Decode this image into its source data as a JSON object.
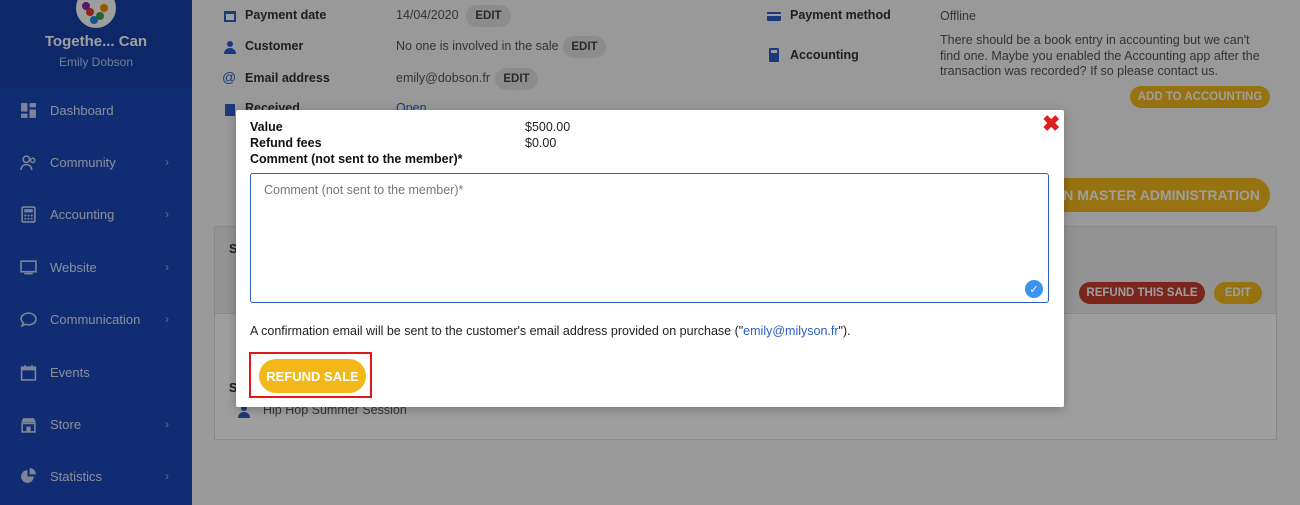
{
  "sidebar": {
    "org_name": "Togethe... Can",
    "user_name": "Emily Dobson",
    "items": [
      {
        "label": "Dashboard",
        "icon": "dashboard-icon",
        "chevron": false
      },
      {
        "label": "Community",
        "icon": "community-icon",
        "chevron": true
      },
      {
        "label": "Accounting",
        "icon": "calculator-icon",
        "chevron": true
      },
      {
        "label": "Website",
        "icon": "monitor-icon",
        "chevron": true
      },
      {
        "label": "Communication",
        "icon": "chat-icon",
        "chevron": true
      },
      {
        "label": "Events",
        "icon": "calendar-icon",
        "chevron": false
      },
      {
        "label": "Store",
        "icon": "store-icon",
        "chevron": true
      },
      {
        "label": "Statistics",
        "icon": "pie-chart-icon",
        "chevron": true
      }
    ],
    "chevron_glyph": "›"
  },
  "details": {
    "payment_date_label": "Payment date",
    "payment_date_value": "14/04/2020",
    "customer_label": "Customer",
    "customer_value": "No one is involved in the sale",
    "email_label": "Email address",
    "email_value": "emily@dobson.fr",
    "received_label": "Received",
    "received_value": "Open",
    "edit_label": "EDIT",
    "payment_method_label": "Payment method",
    "payment_method_value": "Offline",
    "accounting_label": "Accounting",
    "accounting_note": "There should be a book entry in accounting but we can't find one. Maybe you enabled the Accounting app after the transaction was recorded? If so please contact us.",
    "add_to_accounting": "ADD TO ACCOUNTING",
    "master_admin": "IN MASTER ADMINISTRATION",
    "refund_this_sale": "REFUND THIS SALE",
    "product_name": "Hip Hop Summer Session",
    "section_letter_1": "S",
    "section_letter_2": "S"
  },
  "modal": {
    "value_label": "Value",
    "value_amount": "$500.00",
    "refund_fees_label": "Refund fees",
    "refund_fees_amount": "$0.00",
    "comment_label": "Comment (not sent to the member)*",
    "comment_placeholder": "Comment (not sent to the member)*",
    "confirm_prefix": "A confirmation email will be sent to the customer's email address provided on purchase (\"",
    "confirm_email": "emily@milyson.fr",
    "confirm_suffix": "\").",
    "refund_button": "REFUND SALE",
    "close_glyph": "✖"
  },
  "colors": {
    "sidebar": "#1a47b8",
    "accent_yellow": "#f2b81a",
    "danger_red": "#e01818",
    "link_blue": "#2a5ec7"
  }
}
